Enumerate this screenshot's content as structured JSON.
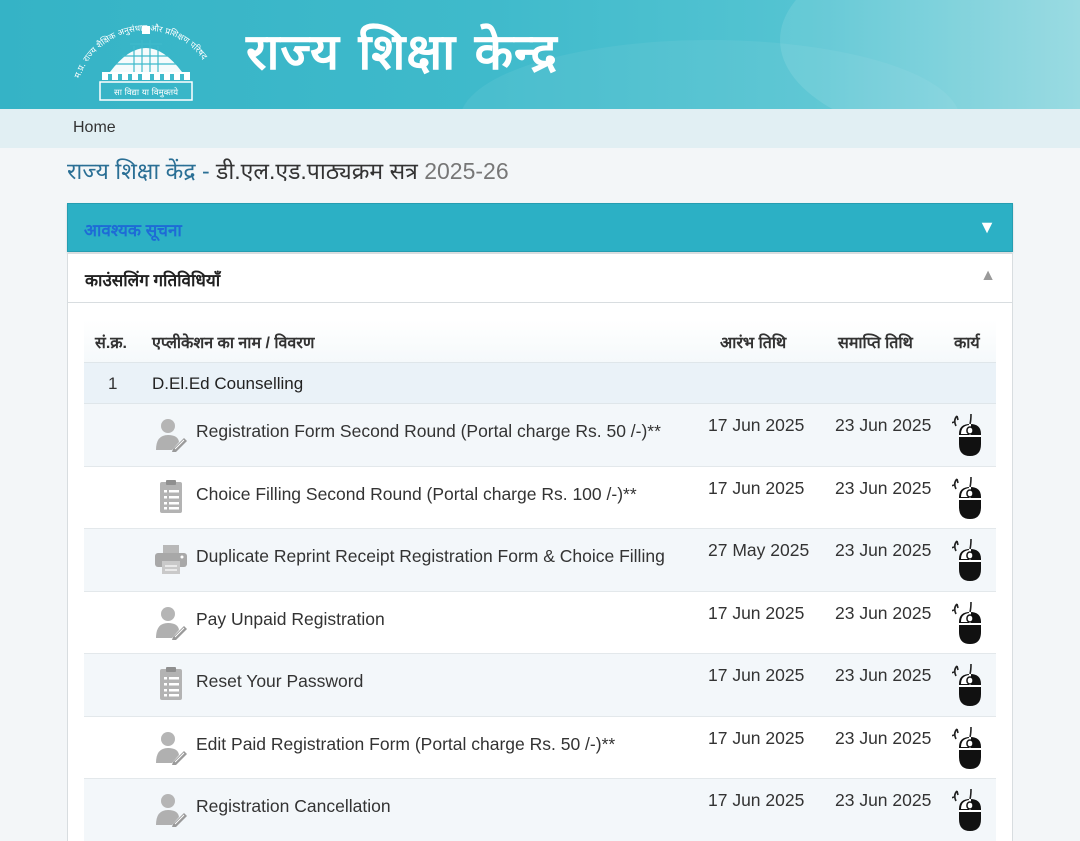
{
  "header": {
    "site_title": "राज्य शिक्षा केन्द्र",
    "logo": {
      "arc_text": "म.प्र. राज्य शैक्षिक अनुसंधान और प्रशिक्षण परिषद",
      "motto": "सा विद्या या विमुक्तये"
    }
  },
  "breadcrumb": {
    "home": "Home"
  },
  "page_title": {
    "part1": "राज्य शिक्षा केंद्र",
    "separator": " - ",
    "part2": "डी.एल.एड.पाठ्यक्रम सत्र ",
    "part3": "2025-26"
  },
  "panels": {
    "notice": {
      "label": "आवश्यक सूचना",
      "caret": "▼"
    },
    "counselling": {
      "label": "काउंसलिंग गतिविधियाँ",
      "caret": "▲"
    }
  },
  "table": {
    "headers": {
      "serial": "सं.क्र.",
      "name": "एप्लीकेशन का नाम / विवरण",
      "start": "आरंभ तिथि",
      "end": "समाप्ति तिथि",
      "action": "कार्य"
    },
    "group": {
      "number": "1",
      "name": "D.El.Ed Counselling"
    },
    "rows": [
      {
        "icon": "user-edit-icon",
        "name": "Registration Form Second Round (Portal charge Rs. 50 /-)**",
        "start": "17 Jun 2025",
        "end": "23 Jun 2025"
      },
      {
        "icon": "checklist-icon",
        "name": "Choice Filling Second Round (Portal charge Rs. 100 /-)**",
        "start": "17 Jun 2025",
        "end": "23 Jun 2025"
      },
      {
        "icon": "printer-icon",
        "name": "Duplicate Reprint Receipt Registration Form & Choice Filling",
        "start": "27 May 2025",
        "end": "23 Jun 2025"
      },
      {
        "icon": "user-edit-icon",
        "name": "Pay Unpaid Registration",
        "start": "17 Jun 2025",
        "end": "23 Jun 2025"
      },
      {
        "icon": "checklist-icon",
        "name": "Reset Your Password",
        "start": "17 Jun 2025",
        "end": "23 Jun 2025"
      },
      {
        "icon": "user-edit-icon",
        "name": "Edit Paid Registration Form (Portal charge Rs. 50 /-)**",
        "start": "17 Jun 2025",
        "end": "23 Jun 2025"
      },
      {
        "icon": "user-edit-icon",
        "name": "Registration Cancellation",
        "start": "17 Jun 2025",
        "end": "23 Jun 2025"
      }
    ],
    "action_icon": "mouse-click-icon"
  },
  "colors": {
    "header_teal": "#3fbacb",
    "notice_bar": "#2cb0c5",
    "notice_label": "#1e6bd6",
    "title_blue": "#2a6f95"
  }
}
